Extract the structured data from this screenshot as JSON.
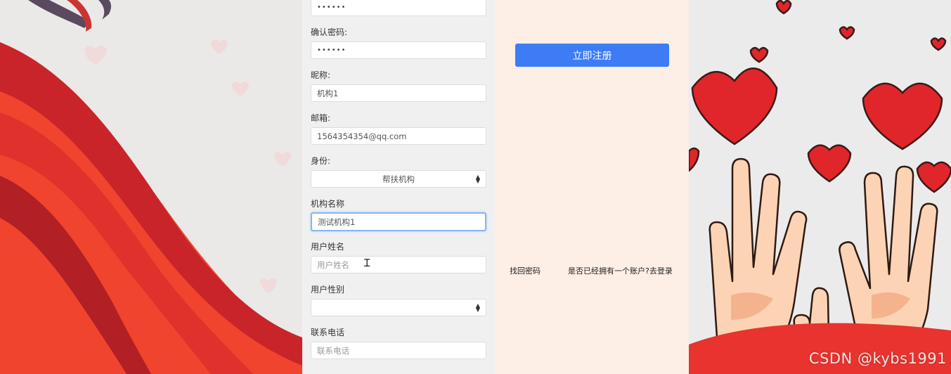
{
  "form": {
    "password_value": "••••••",
    "confirm_password": {
      "label": "确认密码:",
      "value": "••••••"
    },
    "nickname": {
      "label": "昵称:",
      "value": "机构1"
    },
    "email": {
      "label": "邮箱:",
      "value": "1564354354@qq.com"
    },
    "identity": {
      "label": "身份:",
      "selected": "帮扶机构"
    },
    "org_name": {
      "label": "机构名称",
      "value": "测试机构1"
    },
    "user_name": {
      "label": "用户姓名",
      "placeholder": "用户姓名"
    },
    "user_gender": {
      "label": "用户性别",
      "selected": ""
    },
    "phone": {
      "label": "联系电话",
      "placeholder": "联系电话"
    }
  },
  "side": {
    "register_button": "立即注册",
    "forgot_password": "找回密码",
    "login_link": "是否已经拥有一个账户?去登录"
  },
  "watermark": "CSDN @kybs1991",
  "colors": {
    "accent": "#3d7cf5",
    "side_panel_bg": "#fdeee6",
    "ribbon_red": "#e8332e",
    "heart_red": "#e0262a"
  }
}
